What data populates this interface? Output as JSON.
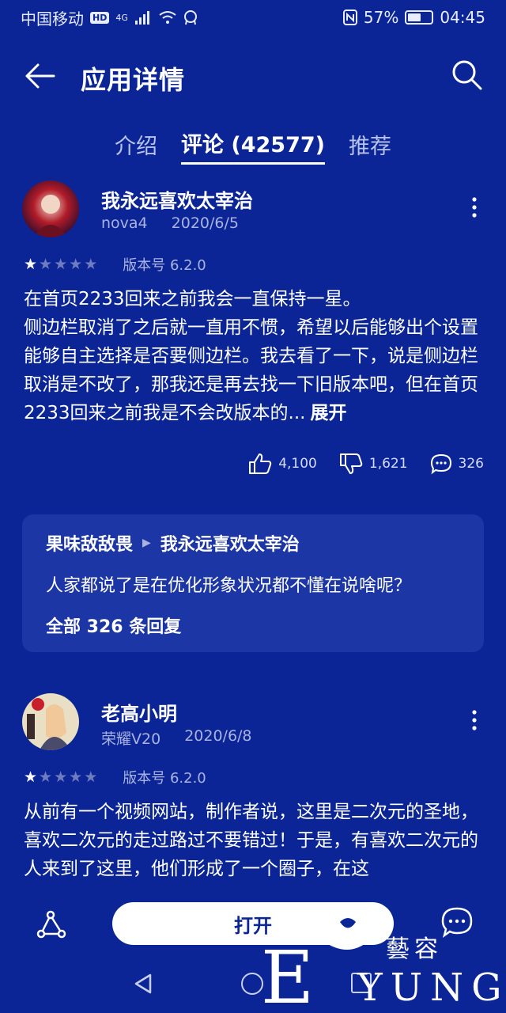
{
  "status_bar": {
    "carrier": "中国移动",
    "hd": "HD",
    "network": "4G",
    "battery": "57%",
    "battery_level": 0.57,
    "time": "04:45"
  },
  "header": {
    "title": "应用详情"
  },
  "tabs": [
    {
      "label": "介绍",
      "active": false
    },
    {
      "label": "评论 (42577)",
      "active": true
    },
    {
      "label": "推荐",
      "active": false
    }
  ],
  "reviews": [
    {
      "author": "我永远喜欢太宰治",
      "device": "nova4",
      "date": "2020/6/5",
      "rating": 1,
      "version": "版本号 6.2.0",
      "text": "在首页2233回来之前我会一直保持一星。\n侧边栏取消了之后就一直用不惯，希望以后能够出个设置能够自主选择是否要侧边栏。我去看了一下，说是侧边栏取消是不改了，那我还是再去找一下旧版本吧，但在首页2233回来之前我是不会改版本的...",
      "expand": "展开",
      "likes": "4,100",
      "dislikes": "1,621",
      "comments": "326",
      "reply": {
        "from": "果味敌敌畏",
        "to": "我永远喜欢太宰治",
        "text": "人家都说了是在优化形象状况都不懂在说啥呢？",
        "all": "全部 326 条回复"
      }
    },
    {
      "author": "老高小明",
      "device": "荣耀V20",
      "date": "2020/6/8",
      "rating": 1,
      "version": "版本号 6.2.0",
      "text": "从前有一个视频网站，制作者说，这里是二次元的圣地，喜欢二次元的走过路过不要错过！于是，有喜欢二次元的人来到了这里，他们形成了一个圈子，在这"
    }
  ],
  "bottom_bar": {
    "open_label": "打开"
  },
  "watermark": {
    "big": "E",
    "small": "YUNG",
    "cn": "藝容"
  },
  "colors": {
    "background": "#0b2596",
    "card": "#1c36a6",
    "text": "#ffffff",
    "muted": "#aab3e0"
  }
}
